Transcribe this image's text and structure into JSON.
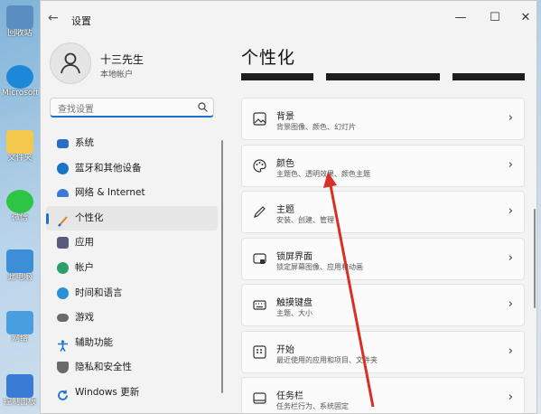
{
  "desktop": {
    "icons": [
      {
        "label": "回收站",
        "color": "#5a8dc0"
      },
      {
        "label": "Microsoft Edge",
        "color": "#1e88d8"
      },
      {
        "label": "文件夹",
        "color": "#f2c94c"
      },
      {
        "label": "微信",
        "color": "#2ec445"
      },
      {
        "label": "此电脑",
        "color": "#3c8fd6"
      },
      {
        "label": "网络",
        "color": "#4a9fe0"
      },
      {
        "label": "控制面板",
        "color": "#3a7bd5"
      }
    ]
  },
  "window": {
    "title": "设置",
    "controls": {
      "minimize": "—",
      "maximize": "☐",
      "close": "✕"
    }
  },
  "profile": {
    "name": "十三先生",
    "account": "本地帐户"
  },
  "search": {
    "placeholder": "查找设置",
    "value": ""
  },
  "nav": {
    "items": [
      {
        "label": "系统",
        "icon": "monitor-icon",
        "color": "#2b6cc4"
      },
      {
        "label": "蓝牙和其他设备",
        "icon": "bluetooth-icon",
        "color": "#1a73c8"
      },
      {
        "label": "网络 & Internet",
        "icon": "wifi-icon",
        "color": "#3a7bd5"
      },
      {
        "label": "个性化",
        "icon": "brush-icon",
        "color": "#d9822b",
        "active": true
      },
      {
        "label": "应用",
        "icon": "apps-icon",
        "color": "#5a5a7a"
      },
      {
        "label": "帐户",
        "icon": "person-icon",
        "color": "#2e9e6a"
      },
      {
        "label": "时间和语言",
        "icon": "globe-clock-icon",
        "color": "#2b8fd6"
      },
      {
        "label": "游戏",
        "icon": "gamepad-icon",
        "color": "#6a6a6a"
      },
      {
        "label": "辅助功能",
        "icon": "accessibility-icon",
        "color": "#1a73c8"
      },
      {
        "label": "隐私和安全性",
        "icon": "shield-icon",
        "color": "#6a6a6a"
      },
      {
        "label": "Windows 更新",
        "icon": "update-icon",
        "color": "#1a73c8"
      }
    ]
  },
  "main": {
    "title": "个性化",
    "cards": [
      {
        "title": "背景",
        "subtitle": "背景图像、颜色、幻灯片",
        "icon": "image-icon"
      },
      {
        "title": "颜色",
        "subtitle": "主题色、透明效果、颜色主题",
        "icon": "palette-icon"
      },
      {
        "title": "主题",
        "subtitle": "安装、创建、管理",
        "icon": "pen-icon"
      },
      {
        "title": "锁屏界面",
        "subtitle": "锁定屏幕图像、应用和动画",
        "icon": "lockscreen-icon"
      },
      {
        "title": "触摸键盘",
        "subtitle": "主题、大小",
        "icon": "keyboard-icon"
      },
      {
        "title": "开始",
        "subtitle": "最近使用的应用和项目、文件夹",
        "icon": "start-icon"
      },
      {
        "title": "任务栏",
        "subtitle": "任务栏行为、系统固定",
        "icon": "taskbar-icon"
      }
    ],
    "chevron": "›"
  },
  "accent_color": "#1a73c8",
  "annotation_color": "#d93025"
}
